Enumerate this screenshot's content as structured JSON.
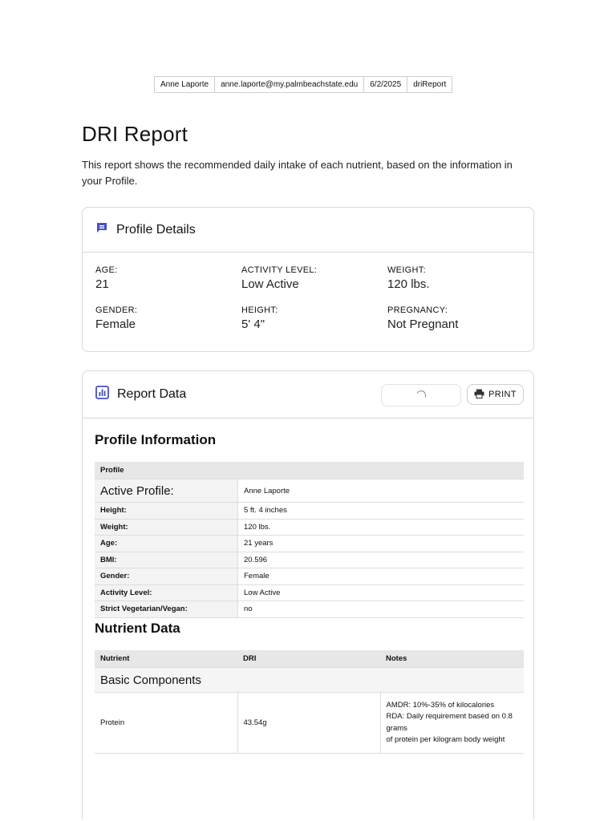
{
  "meta": {
    "name": "Anne Laporte",
    "email": "anne.laporte@my.palmbeachstate.edu",
    "date": "6/2/2025",
    "report_id": "driReport"
  },
  "page": {
    "title": "DRI Report",
    "intro": "This report shows the recommended daily intake of each nutrient, based on the information in your Profile."
  },
  "profile_details": {
    "title": "Profile Details",
    "icon": "comment-icon",
    "accent": "#4a4fc4",
    "fields": [
      {
        "label": "AGE:",
        "value": "21"
      },
      {
        "label": "ACTIVITY LEVEL:",
        "value": "Low Active"
      },
      {
        "label": "WEIGHT:",
        "value": "120 lbs."
      },
      {
        "label": "GENDER:",
        "value": "Female"
      },
      {
        "label": "HEIGHT:",
        "value": "5' 4\""
      },
      {
        "label": "PREGNANCY:",
        "value": "Not Pregnant"
      }
    ]
  },
  "report_data": {
    "title": "Report Data",
    "icon": "bar-chart-icon",
    "print_label": "PRINT",
    "profile_section": {
      "heading": "Profile Information",
      "table_header": "Profile",
      "rows": [
        {
          "label": "Active Profile:",
          "value": "Anne Laporte"
        },
        {
          "label": "Height:",
          "value": "5 ft. 4 inches"
        },
        {
          "label": "Weight:",
          "value": "120 lbs."
        },
        {
          "label": "Age:",
          "value": "21 years"
        },
        {
          "label": "BMI:",
          "value": "20.596"
        },
        {
          "label": "Gender:",
          "value": "Female"
        },
        {
          "label": "Activity Level:",
          "value": "Low Active"
        },
        {
          "label": "Strict Vegetarian/Vegan:",
          "value": "no"
        }
      ]
    },
    "nutrient_section": {
      "heading": "Nutrient Data",
      "columns": [
        "Nutrient",
        "DRI",
        "Notes"
      ],
      "subsection": "Basic Components",
      "rows": [
        {
          "nutrient": "Protein",
          "dri": "43.54g",
          "notes": [
            "AMDR: 10%-35% of kilocalories",
            "RDA: Daily requirement based on 0.8 grams",
            "of protein per kilogram body weight"
          ]
        }
      ]
    }
  }
}
